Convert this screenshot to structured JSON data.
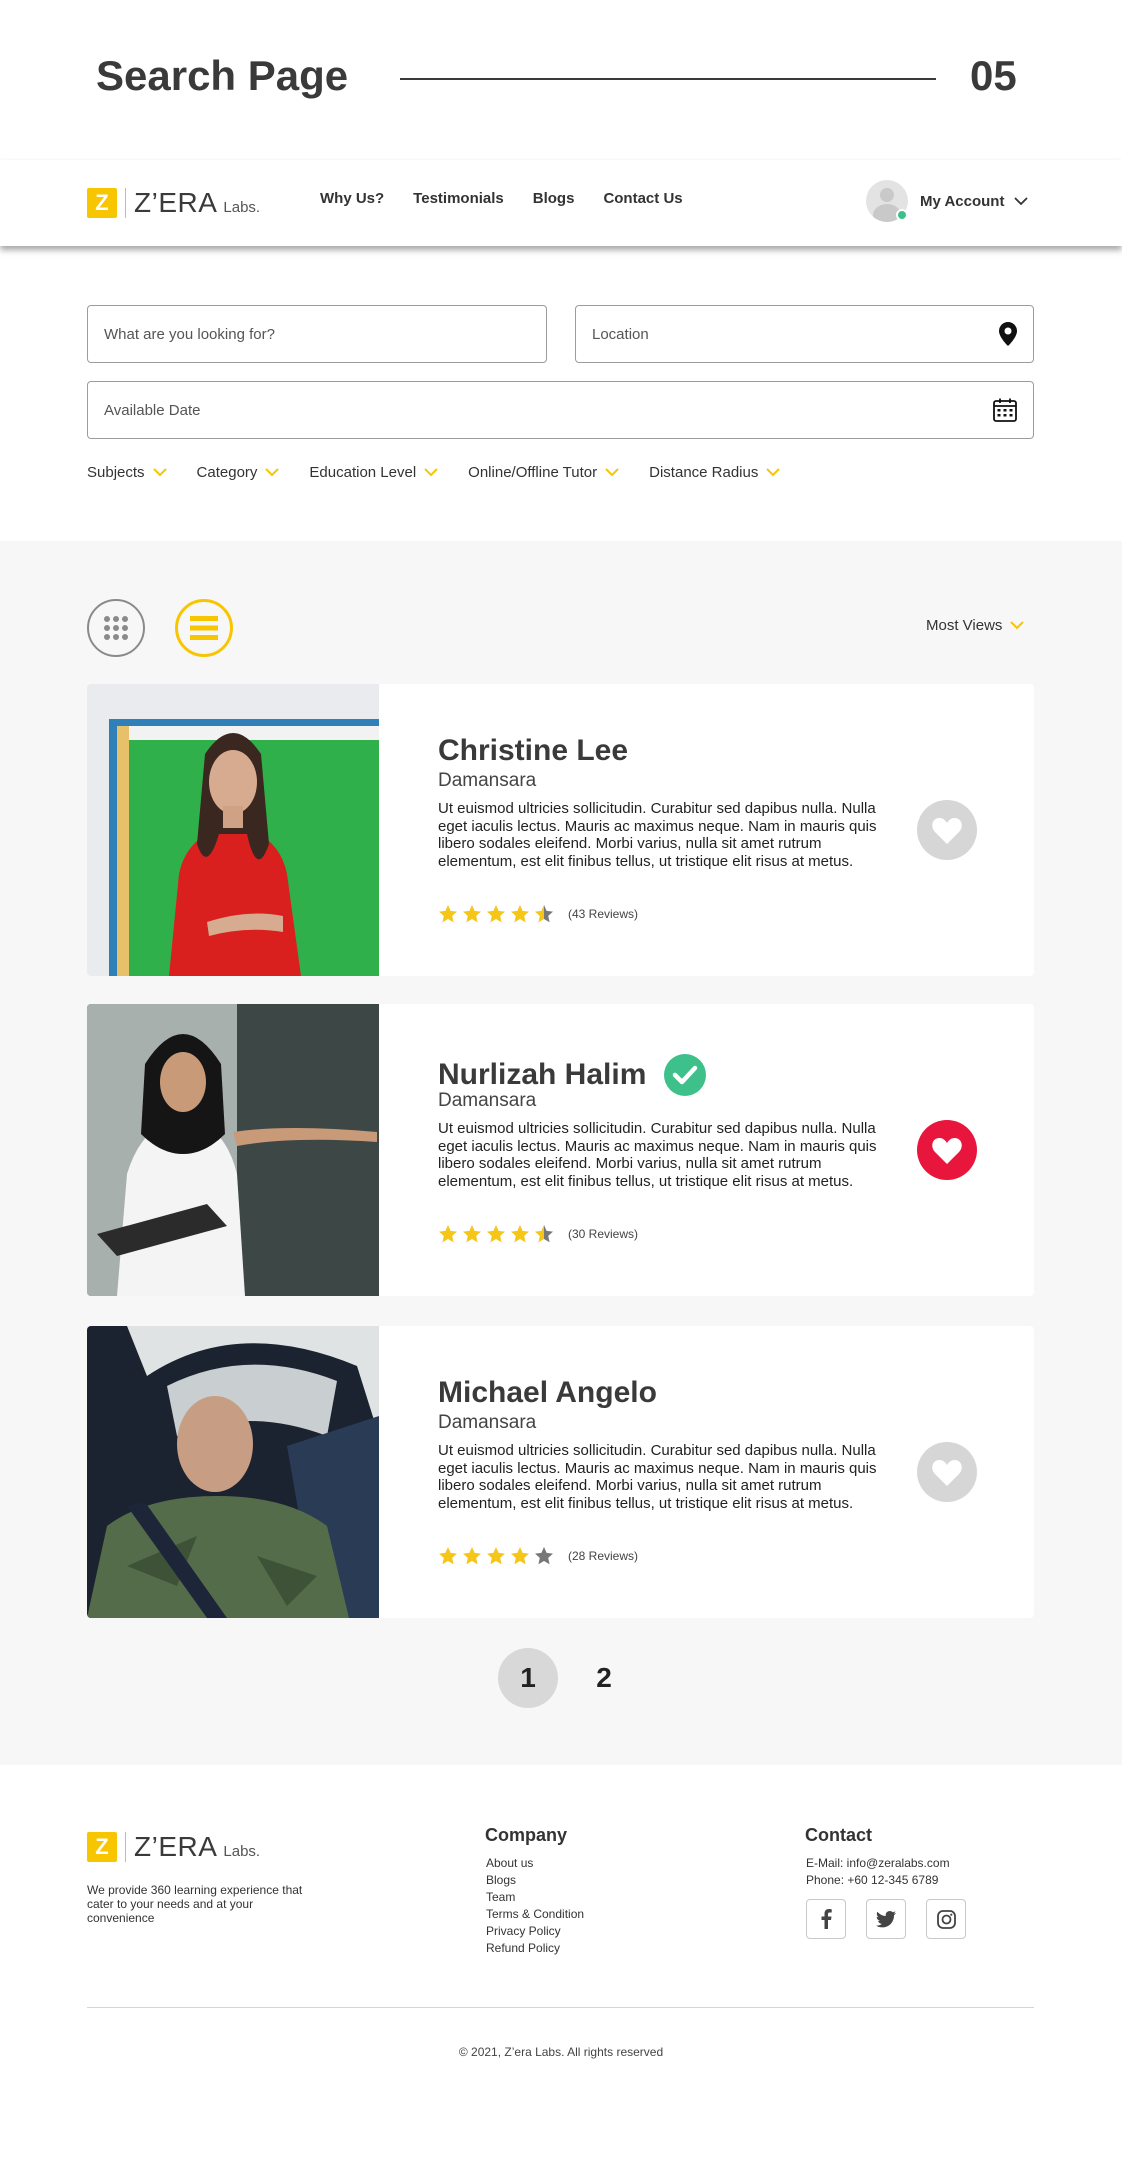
{
  "slide": {
    "title": "Search Page",
    "number": "05"
  },
  "brand": {
    "mark": "Z",
    "name": "Z’ERA",
    "suffix": "Labs.",
    "accent": "#f7c600"
  },
  "nav": {
    "links": [
      "Why Us?",
      "Testimonials",
      "Blogs",
      "Contact Us"
    ],
    "account_label": "My Account"
  },
  "search": {
    "keyword_placeholder": "What are you looking for?",
    "location_placeholder": "Location",
    "date_placeholder": "Available Date",
    "filters": [
      "Subjects",
      "Category",
      "Education Level",
      "Online/Offline Tutor",
      "Distance Radius"
    ]
  },
  "results": {
    "sort_label": "Most Views",
    "view_modes": [
      "grid-icon",
      "list-icon"
    ],
    "active_view": "list",
    "tutors": [
      {
        "name": "Christine Lee",
        "location": "Damansara",
        "description": "Ut euismod ultricies sollicitudin. Curabitur sed dapibus nulla. Nulla eget iaculis lectus. Mauris ac maximus neque. Nam in mauris quis libero sodales eleifend. Morbi varius, nulla sit amet rutrum elementum, est elit finibus tellus, ut tristique elit risus at metus.",
        "rating": 4.5,
        "reviews": "(43 Reviews)",
        "verified": false,
        "favorited": false
      },
      {
        "name": "Nurlizah Halim",
        "location": "Damansara",
        "description": "Ut euismod ultricies sollicitudin. Curabitur sed dapibus nulla. Nulla eget iaculis lectus. Mauris ac maximus neque. Nam in mauris quis libero sodales eleifend. Morbi varius, nulla sit amet rutrum elementum, est elit finibus tellus, ut tristique elit risus at metus.",
        "rating": 4.5,
        "reviews": "(30 Reviews)",
        "verified": true,
        "favorited": true
      },
      {
        "name": "Michael Angelo",
        "location": "Damansara",
        "description": "Ut euismod ultricies sollicitudin. Curabitur sed dapibus nulla. Nulla eget iaculis lectus. Mauris ac maximus neque. Nam in mauris quis libero sodales eleifend. Morbi varius, nulla sit amet rutrum elementum, est elit finibus tellus, ut tristique elit risus at metus.",
        "rating": 4,
        "reviews": "(28 Reviews)",
        "verified": false,
        "favorited": false
      }
    ],
    "pagination": {
      "pages": [
        "1",
        "2"
      ],
      "current": "1"
    }
  },
  "footer": {
    "tagline": "We provide 360 learning experience that cater to your needs and at your convenience",
    "company": {
      "title": "Company",
      "links": [
        "About us",
        "Blogs",
        "Team",
        "Terms & Condition",
        "Privacy Policy",
        "Refund Policy"
      ]
    },
    "contact": {
      "title": "Contact",
      "email": "E-Mail: info@zeralabs.com",
      "phone": "Phone: +60 12-345 6789",
      "socials": [
        "facebook-icon",
        "twitter-icon",
        "instagram-icon"
      ]
    },
    "copyright": "© 2021, Z’era Labs. All rights reserved"
  },
  "colors": {
    "star": "#f5c518",
    "star_empty": "#777777",
    "verified": "#3ec08b",
    "favorite_active": "#e8163c",
    "favorite_inactive": "#d6d6d6"
  }
}
